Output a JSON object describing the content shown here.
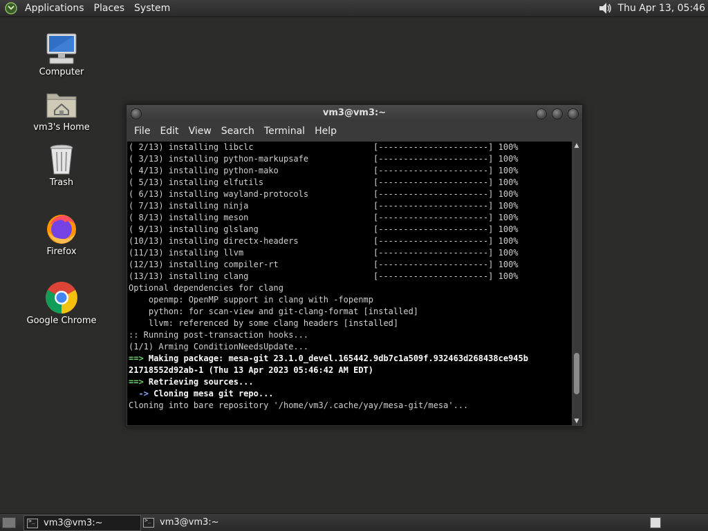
{
  "top_panel": {
    "menus": [
      "Applications",
      "Places",
      "System"
    ],
    "clock": "Thu Apr 13, 05:46"
  },
  "desktop_icons": [
    {
      "label": "Computer",
      "icon": "computer-icon"
    },
    {
      "label": "vm3's Home",
      "icon": "home-folder-icon"
    },
    {
      "label": "Trash",
      "icon": "trash-icon"
    },
    {
      "label": "Firefox",
      "icon": "firefox-icon"
    },
    {
      "label": "Google Chrome",
      "icon": "chrome-icon"
    }
  ],
  "window": {
    "title": "vm3@vm3:~",
    "menus": [
      "File",
      "Edit",
      "View",
      "Search",
      "Terminal",
      "Help"
    ],
    "scroll_position": 0.9,
    "lines": [
      {
        "text": "( 2/13) installing libclc                        [----------------------] 100%"
      },
      {
        "text": "( 3/13) installing python-markupsafe             [----------------------] 100%"
      },
      {
        "text": "( 4/13) installing python-mako                   [----------------------] 100%"
      },
      {
        "text": "( 5/13) installing elfutils                      [----------------------] 100%"
      },
      {
        "text": "( 6/13) installing wayland-protocols             [----------------------] 100%"
      },
      {
        "text": "( 7/13) installing ninja                         [----------------------] 100%"
      },
      {
        "text": "( 8/13) installing meson                         [----------------------] 100%"
      },
      {
        "text": "( 9/13) installing glslang                       [----------------------] 100%"
      },
      {
        "text": "(10/13) installing directx-headers               [----------------------] 100%"
      },
      {
        "text": "(11/13) installing llvm                          [----------------------] 100%"
      },
      {
        "text": "(12/13) installing compiler-rt                   [----------------------] 100%"
      },
      {
        "text": "(13/13) installing clang                         [----------------------] 100%"
      },
      {
        "text": "Optional dependencies for clang"
      },
      {
        "text": "    openmp: OpenMP support in clang with -fopenmp"
      },
      {
        "text": "    python: for scan-view and git-clang-format [installed]"
      },
      {
        "text": "    llvm: referenced by some clang headers [installed]"
      },
      {
        "text": ":: Running post-transaction hooks..."
      },
      {
        "text": "(1/1) Arming ConditionNeedsUpdate..."
      },
      {
        "prefix": "==>",
        "prefix_class": "arrow",
        "text": " Making package: mesa-git 23.1.0_devel.165442.9db7c1a509f.932463d268438ce945b",
        "bold": true
      },
      {
        "text": "21718552d92ab-1 (Thu 13 Apr 2023 05:46:42 AM EDT)",
        "bold": true
      },
      {
        "prefix": "==>",
        "prefix_class": "arrow",
        "text": " Retrieving sources...",
        "bold": true
      },
      {
        "prefix": "  ->",
        "prefix_class": "arrow2",
        "text": " Cloning mesa git repo...",
        "bold": true
      },
      {
        "text": "Cloning into bare repository '/home/vm3/.cache/yay/mesa-git/mesa'..."
      }
    ]
  },
  "taskbar": {
    "tasks": [
      {
        "label": "vm3@vm3:~",
        "active": true
      },
      {
        "label": "vm3@vm3:~",
        "active": false
      }
    ]
  }
}
